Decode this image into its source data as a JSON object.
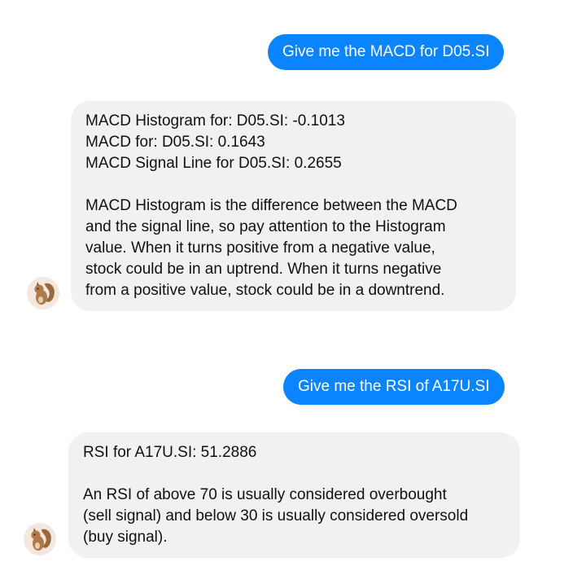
{
  "messages": [
    {
      "sender": "user",
      "text": "Give me the MACD for D05.SI"
    },
    {
      "sender": "bot",
      "lines": [
        "MACD Histogram for: D05.SI: -0.1013",
        "MACD for: D05.SI: 0.1643",
        "MACD Signal Line for D05.SI: 0.2655"
      ],
      "paragraph_lines": [
        "MACD Histogram is the difference between the MACD",
        "and the signal line, so pay attention to the Histogram",
        "value. When it turns positive from a negative value,",
        "stock could be in an uptrend. When it turns negative",
        "from a positive value, stock could be in a downtrend."
      ]
    },
    {
      "sender": "user",
      "text": "Give me the RSI of A17U.SI"
    },
    {
      "sender": "bot",
      "lines": [
        "RSI for A17U.SI: 51.2886"
      ],
      "paragraph_lines": [
        "An RSI of above 70 is usually considered overbought",
        "(sell signal) and below 30 is usually considered oversold",
        "(buy signal)."
      ]
    }
  ],
  "avatar": {
    "icon": "squirrel-avatar-icon"
  },
  "colors": {
    "user_bubble": "#0a84ff",
    "bot_bubble": "#f1f1f1",
    "avatar_bg": "#f3e7df"
  }
}
